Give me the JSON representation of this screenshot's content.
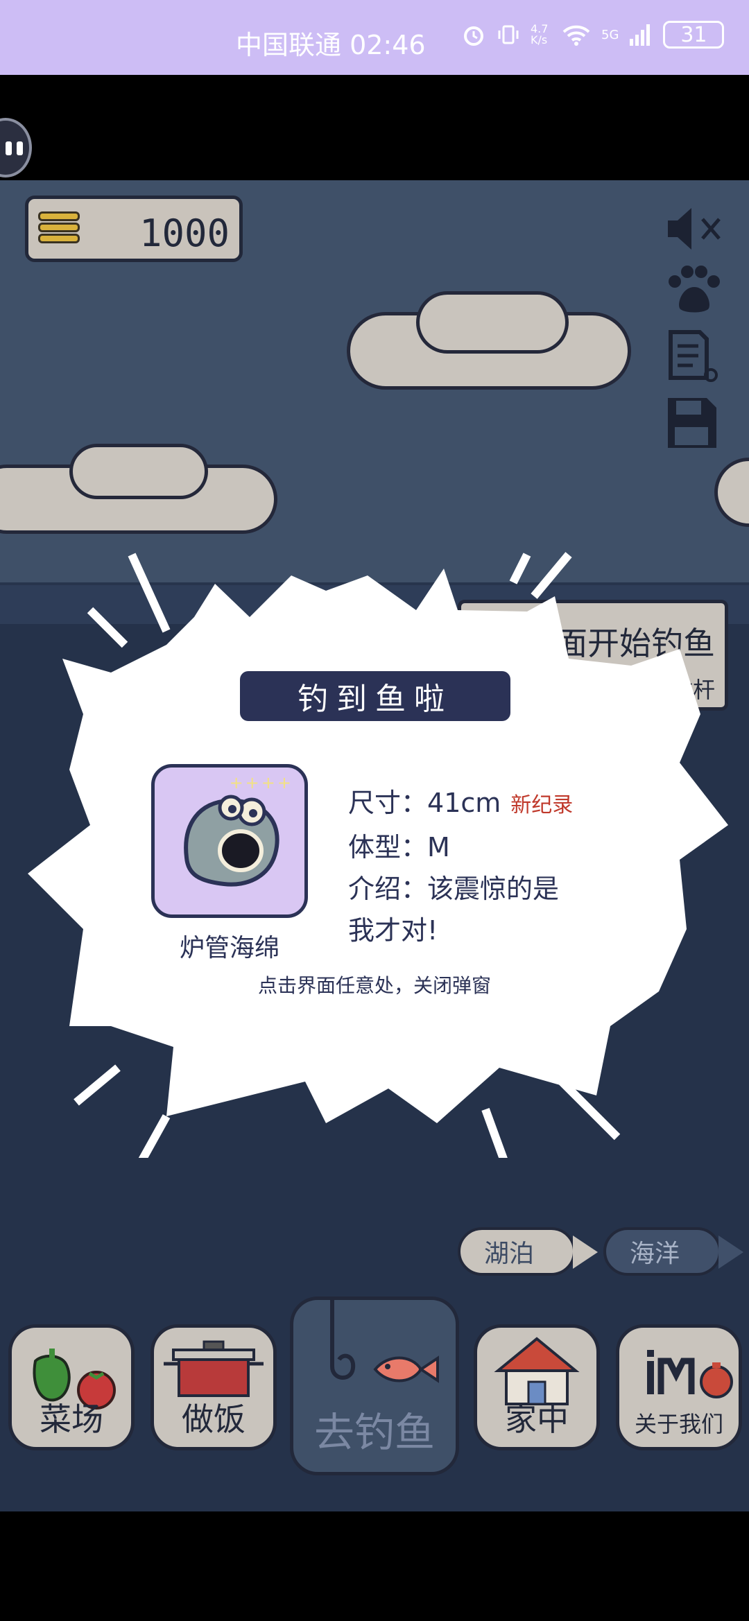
{
  "status_bar": {
    "carrier_time": "中国联通 02:46",
    "net_speed": "4.7\nK/s",
    "signal": "5G",
    "battery": "31"
  },
  "game": {
    "coins": "1000",
    "tip_sign": {
      "line1": "水面开始钓鱼",
      "line2": "收杆"
    },
    "fish_signs": [
      "湖泊",
      "海洋"
    ],
    "icons": [
      "sound-muted-icon",
      "paw-icon",
      "notes-icon",
      "save-icon"
    ]
  },
  "popup": {
    "title": "钓到鱼啦",
    "fish_name": "炉管海绵",
    "stars": "++++",
    "size_label": "尺寸：",
    "size_value": "41cm",
    "new_record": "新纪录",
    "body_label": "体型：",
    "body_value": "M",
    "intro_label": "介绍：",
    "intro_line1": "该震惊的是",
    "intro_line2": "我才对!",
    "close_hint": "点击界面任意处，关闭弹窗"
  },
  "nav": {
    "items": [
      {
        "label": "菜场"
      },
      {
        "label": "做饭"
      },
      {
        "label": "去钓鱼"
      },
      {
        "label": "家中"
      },
      {
        "label": "关于我们"
      }
    ]
  },
  "colors": {
    "sky": "#3f5068",
    "sea": "#25324a",
    "panel": "#c9c4bd",
    "popup_title_bg": "#2b3256",
    "record_red": "#c0392b",
    "card_bg": "#d9c7f3"
  }
}
